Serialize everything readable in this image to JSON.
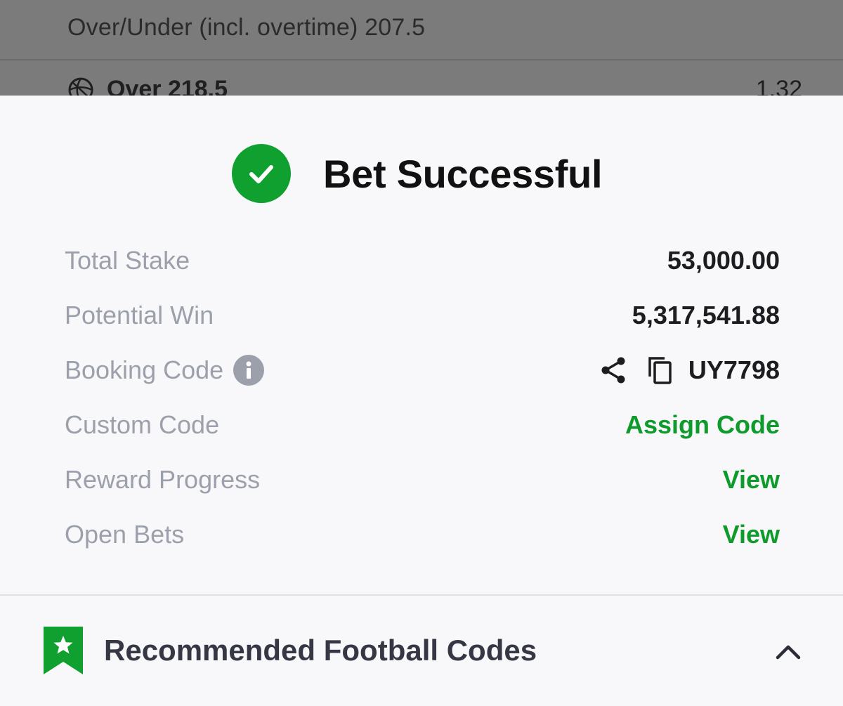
{
  "background": {
    "market_title": "Over/Under (incl. overtime) 207.5",
    "selection": "Over 218.5",
    "odds": "1.32",
    "sport_icon": "basketball-icon"
  },
  "success": {
    "title": "Bet Successful",
    "icon": "check-circle-icon",
    "accent_color": "#0fa02f"
  },
  "details": {
    "total_stake": {
      "label": "Total Stake",
      "value": "53,000.00"
    },
    "potential_win": {
      "label": "Potential Win",
      "value": "5,317,541.88"
    },
    "booking_code": {
      "label": "Booking Code",
      "value": "UY7798",
      "icons": [
        "info-icon",
        "share-icon",
        "copy-icon"
      ]
    },
    "custom_code": {
      "label": "Custom Code",
      "value": "Assign Code"
    },
    "reward_progress": {
      "label": "Reward Progress",
      "value": "View"
    },
    "open_bets": {
      "label": "Open Bets",
      "value": "View"
    }
  },
  "recommended": {
    "title": "Recommended Football Codes",
    "icon": "bookmark-star-icon",
    "toggle_icon": "chevron-up-icon"
  },
  "colors": {
    "link_green": "#0f9a2c",
    "label_gray": "#9ba0ab",
    "value_dark": "#1b1d21",
    "overlay": "#7b7b7b"
  }
}
